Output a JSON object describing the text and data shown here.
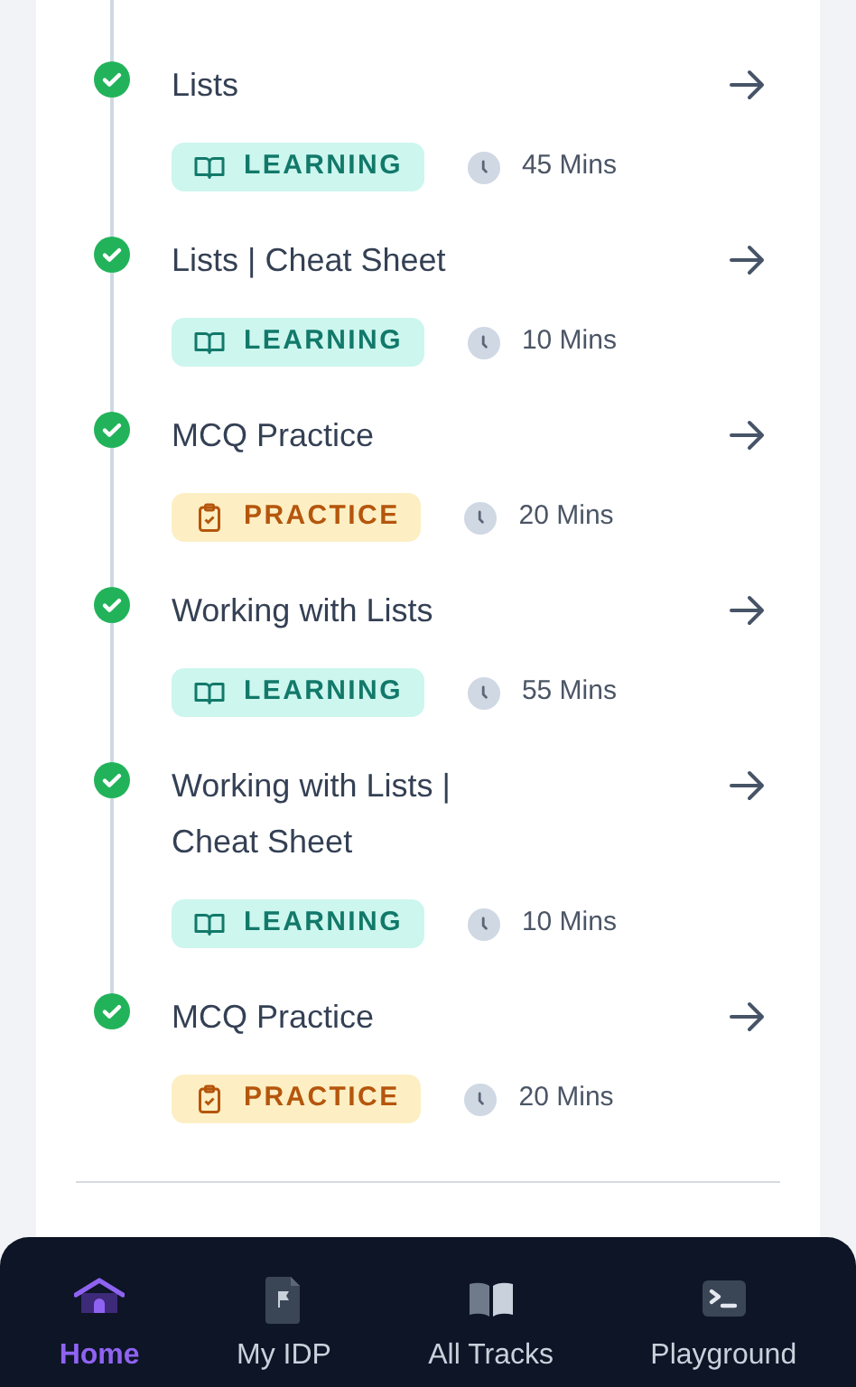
{
  "lessons": [
    {
      "title": "Lists",
      "completed": true,
      "tag": {
        "kind": "learning",
        "label": "LEARNING"
      },
      "duration": "45 Mins"
    },
    {
      "title": "Lists | Cheat Sheet",
      "completed": true,
      "tag": {
        "kind": "learning",
        "label": "LEARNING"
      },
      "duration": "10 Mins"
    },
    {
      "title": "MCQ Practice",
      "completed": true,
      "tag": {
        "kind": "practice",
        "label": "PRACTICE"
      },
      "duration": "20 Mins"
    },
    {
      "title": "Working with Lists",
      "completed": true,
      "tag": {
        "kind": "learning",
        "label": "LEARNING"
      },
      "duration": "55 Mins"
    },
    {
      "title": "Working with Lists | Cheat Sheet",
      "completed": true,
      "tag": {
        "kind": "learning",
        "label": "LEARNING"
      },
      "duration": "10 Mins"
    },
    {
      "title": "MCQ Practice",
      "completed": true,
      "tag": {
        "kind": "practice",
        "label": "PRACTICE"
      },
      "duration": "20 Mins"
    }
  ],
  "bottom_nav": [
    {
      "kind": "home",
      "label": "Home",
      "selected": true
    },
    {
      "kind": "idp",
      "label": "My IDP",
      "selected": false
    },
    {
      "kind": "tracks",
      "label": "All Tracks",
      "selected": false
    },
    {
      "kind": "playground",
      "label": "Playground",
      "selected": false
    }
  ]
}
